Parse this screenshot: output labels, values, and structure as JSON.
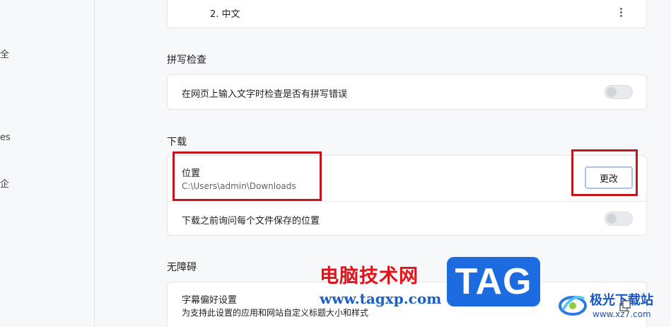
{
  "sidebar": {
    "items": [
      {
        "label": "全"
      },
      {
        "label": "es"
      },
      {
        "label": "企"
      }
    ]
  },
  "languages": {
    "item_label": "2. 中文"
  },
  "spellcheck": {
    "title": "拼写检查",
    "row_label": "在网页上输入文字时检查是否有拼写错误",
    "enabled": false
  },
  "downloads": {
    "title": "下载",
    "location_label": "位置",
    "location_path": "C:\\Users\\admin\\Downloads",
    "change_button": "更改",
    "ask_label": "下载之前询问每个文件保存的位置",
    "ask_enabled": false
  },
  "accessibility": {
    "title": "无障碍",
    "captions_label": "字幕偏好设置",
    "captions_desc": "为支持此设置的应用和网站自定义标题大小和样式"
  },
  "watermark": {
    "cn_text": "电脑技术网",
    "url_text": "www.tagxp.com",
    "tag_text": "TAG",
    "site_name": "极光下载站",
    "site_url": "www.xz7.com"
  },
  "colors": {
    "highlight": "#c0161c",
    "button_border": "#a9c6ea",
    "tag_bg": "#1d6be0"
  }
}
